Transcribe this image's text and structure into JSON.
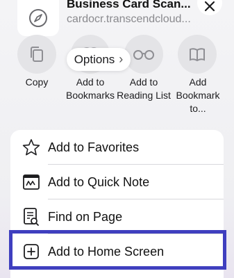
{
  "header": {
    "title": "Business Card Scan...",
    "url": "cardocr.transcendcloud...",
    "app_icon": "compass-icon",
    "close_icon": "close-icon"
  },
  "actions": [
    {
      "label": "Copy",
      "icon": "copy-icon"
    },
    {
      "label": "Add to Bookmarks",
      "icon": "book-icon"
    },
    {
      "label": "Add to Reading List",
      "icon": "glasses-icon"
    },
    {
      "label": "Add Bookmark to...",
      "icon": "book-open-icon"
    }
  ],
  "options": {
    "label": "Options",
    "chevron": "›"
  },
  "menu": [
    {
      "label": "Add to Favorites",
      "icon": "star-icon"
    },
    {
      "label": "Add to Quick Note",
      "icon": "quick-note-icon"
    },
    {
      "label": "Find on Page",
      "icon": "find-on-page-icon"
    },
    {
      "label": "Add to Home Screen",
      "icon": "add-square-icon"
    }
  ],
  "colors": {
    "highlight": "#3f3fbf",
    "secondary_text": "#8a8a8e",
    "background": "#f4f4f6"
  }
}
